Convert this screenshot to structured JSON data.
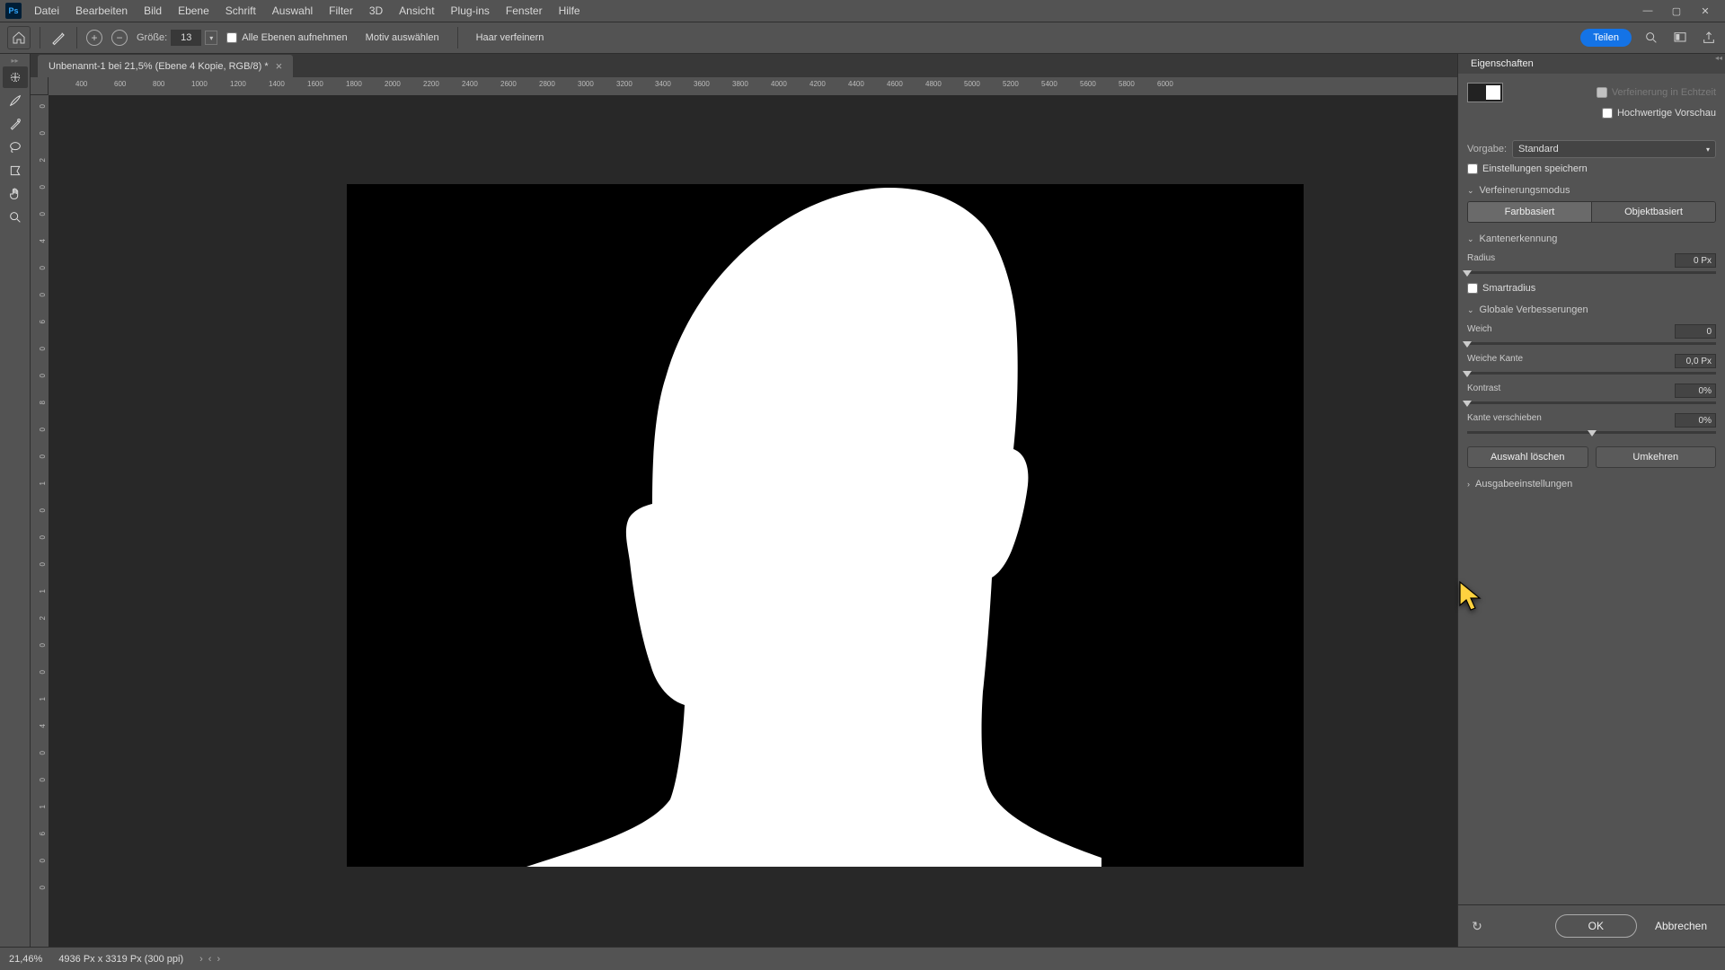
{
  "menu": {
    "items": [
      "Datei",
      "Bearbeiten",
      "Bild",
      "Ebene",
      "Schrift",
      "Auswahl",
      "Filter",
      "3D",
      "Ansicht",
      "Plug-ins",
      "Fenster",
      "Hilfe"
    ]
  },
  "options": {
    "size_label": "Größe:",
    "size_value": "13",
    "sample_all": "Alle Ebenen aufnehmen",
    "select_subject": "Motiv auswählen",
    "refine_hair": "Haar verfeinern",
    "share": "Teilen"
  },
  "doc": {
    "title": "Unbenannt-1 bei 21,5% (Ebene 4 Kopie, RGB/8) *"
  },
  "hruler_ticks": [
    "400",
    "600",
    "800",
    "1000",
    "1200",
    "1400",
    "1600",
    "1800",
    "2000",
    "2200",
    "2400",
    "2600",
    "2800",
    "3000",
    "3200",
    "3400",
    "3600",
    "3800",
    "4000",
    "4200",
    "4400",
    "4600",
    "4800",
    "5000",
    "5200",
    "5400",
    "5600",
    "5800",
    "6000"
  ],
  "vruler_ticks": [
    "0",
    "0",
    "2",
    "0",
    "0",
    "4",
    "0",
    "0",
    "6",
    "0",
    "0",
    "8",
    "0",
    "0",
    "1",
    "0",
    "0",
    "0",
    "1",
    "2",
    "0",
    "0",
    "1",
    "4",
    "0",
    "0",
    "1",
    "6",
    "0",
    "0"
  ],
  "panel": {
    "title": "Eigenschaften",
    "realtime_refine": "Verfeinerung in Echtzeit",
    "hq_preview": "Hochwertige Vorschau",
    "preset_label": "Vorgabe:",
    "preset_value": "Standard",
    "remember": "Einstellungen speichern",
    "mode_header": "Verfeinerungsmodus",
    "mode_color": "Farbbasiert",
    "mode_object": "Objektbasiert",
    "edge_header": "Kantenerkennung",
    "radius_label": "Radius",
    "radius_value": "0 Px",
    "smart_radius": "Smartradius",
    "global_header": "Globale Verbesserungen",
    "smooth_label": "Weich",
    "smooth_value": "0",
    "feather_label": "Weiche Kante",
    "feather_value": "0,0 Px",
    "contrast_label": "Kontrast",
    "contrast_value": "0%",
    "shift_label": "Kante verschieben",
    "shift_value": "0%",
    "clear_sel": "Auswahl löschen",
    "invert": "Umkehren",
    "output_header": "Ausgabeeinstellungen",
    "ok": "OK",
    "cancel": "Abbrechen"
  },
  "status": {
    "zoom": "21,46%",
    "doc_info": "4936 Px x 3319 Px (300 ppi)"
  }
}
